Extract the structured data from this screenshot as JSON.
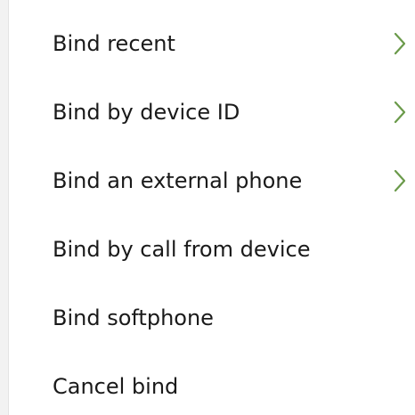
{
  "menu": {
    "accent_color": "#6a9a4a",
    "items": [
      {
        "label": "Bind recent",
        "has_submenu": true,
        "icon": "chevron-right-icon"
      },
      {
        "label": "Bind by device ID",
        "has_submenu": true,
        "icon": "chevron-right-icon"
      },
      {
        "label": "Bind an external phone",
        "has_submenu": true,
        "icon": "chevron-right-icon"
      },
      {
        "label": "Bind by call from device",
        "has_submenu": false
      },
      {
        "label": "Bind softphone",
        "has_submenu": false
      },
      {
        "label": "Cancel bind",
        "has_submenu": false
      }
    ]
  }
}
